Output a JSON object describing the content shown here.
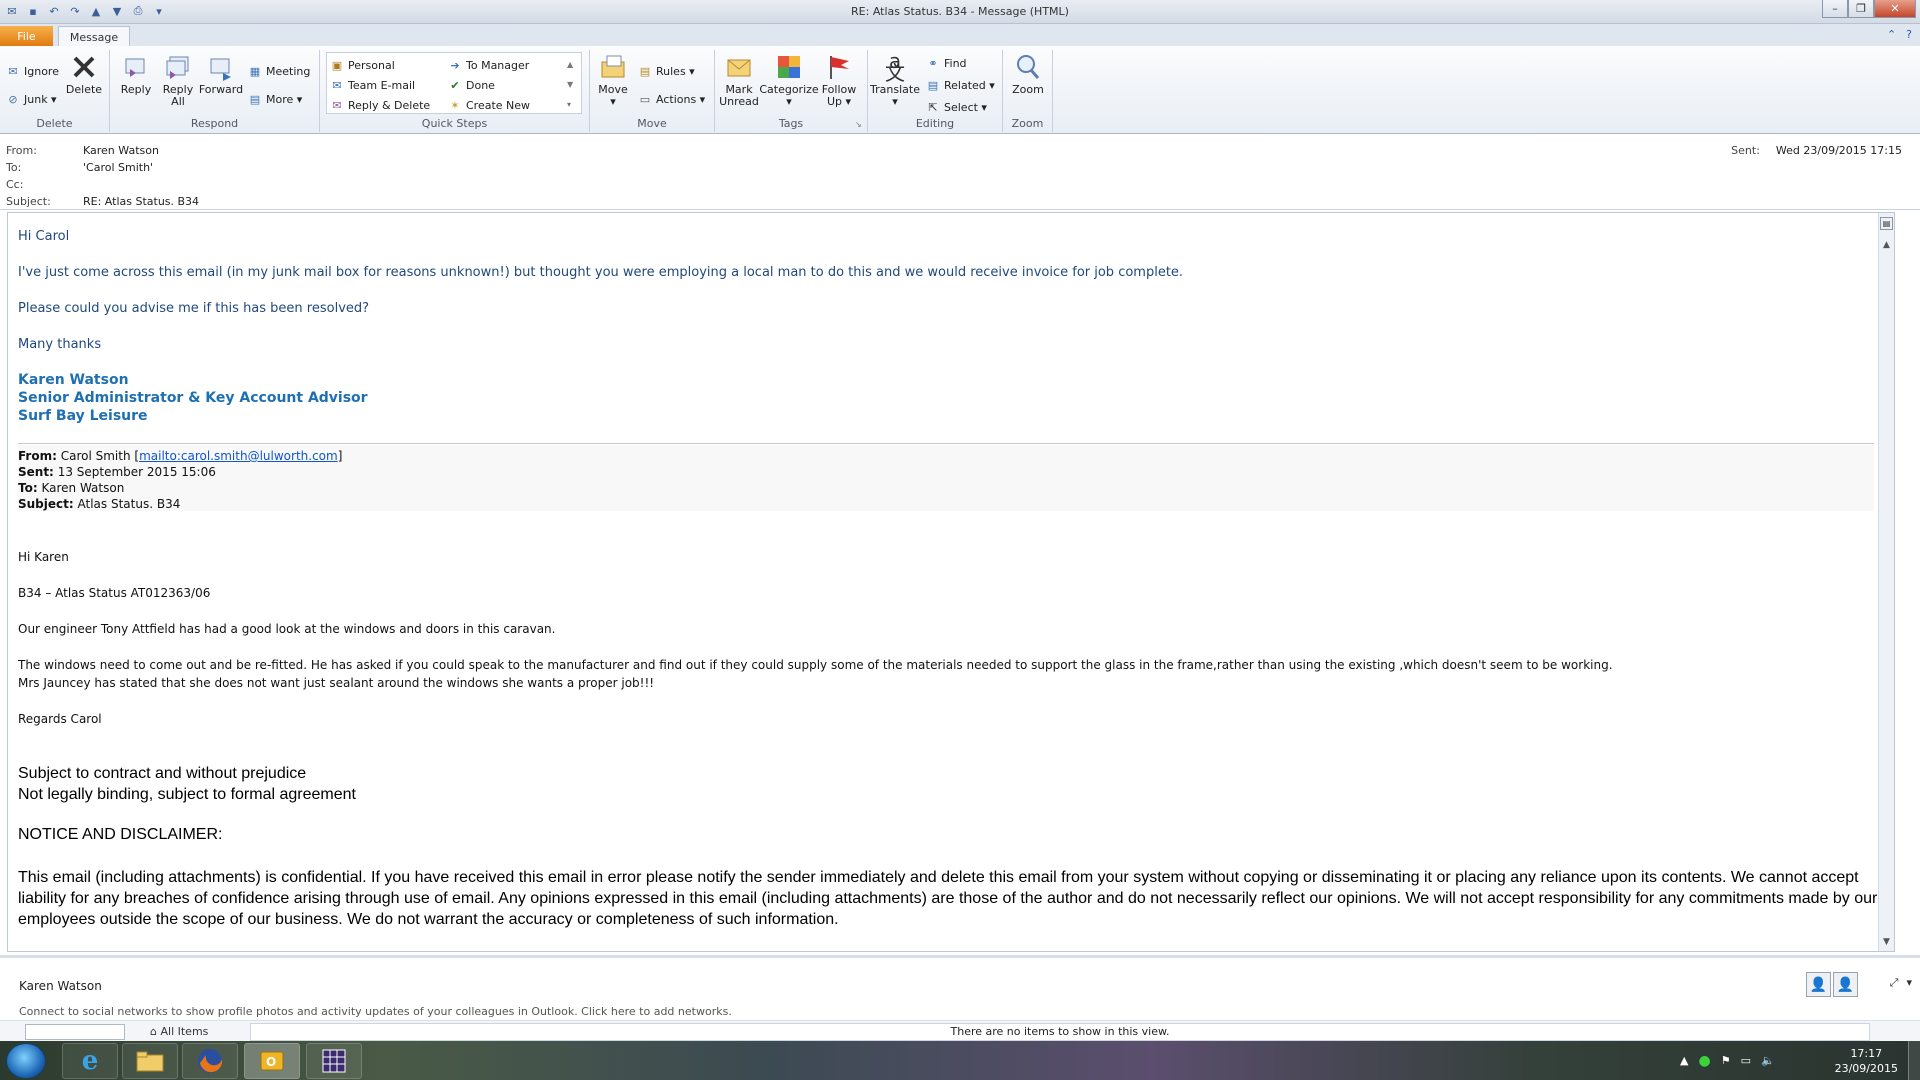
{
  "window": {
    "title": "RE: Atlas Status.  B34  -  Message (HTML)"
  },
  "tabs": {
    "file": "File",
    "message": "Message"
  },
  "ribbon": {
    "delete": {
      "ignore": "Ignore",
      "junk": "Junk ▾",
      "delete": "Delete",
      "label": "Delete"
    },
    "respond": {
      "reply": "Reply",
      "reply_all_1": "Reply",
      "reply_all_2": "All",
      "forward": "Forward",
      "meeting": "Meeting",
      "more": "More ▾",
      "label": "Respond"
    },
    "quick_steps": {
      "personal": "Personal",
      "team_email": "Team E-mail",
      "reply_delete": "Reply & Delete",
      "to_manager": "To Manager",
      "done": "Done",
      "create_new": "Create New",
      "label": "Quick Steps"
    },
    "move": {
      "move_1": "Move",
      "move_2": "▾",
      "rules": "Rules ▾",
      "actions": "Actions ▾",
      "label": "Move"
    },
    "tags": {
      "mark_unread_1": "Mark",
      "mark_unread_2": "Unread",
      "categorize_1": "Categorize",
      "categorize_2": "▾",
      "follow_up_1": "Follow",
      "follow_up_2": "Up ▾",
      "label": "Tags"
    },
    "editing": {
      "translate_1": "Translate",
      "translate_2": "▾",
      "find": "Find",
      "related": "Related ▾",
      "select": "Select ▾",
      "label": "Editing"
    },
    "zoom": {
      "zoom": "Zoom",
      "label": "Zoom"
    }
  },
  "headers": {
    "from_label": "From:",
    "from": "Karen Watson",
    "to_label": "To:",
    "to": "'Carol Smith'",
    "cc_label": "Cc:",
    "cc": "",
    "subject_label": "Subject:",
    "subject": "RE: Atlas Status.  B34",
    "sent_label": "Sent:",
    "sent": "Wed 23/09/2015 17:15"
  },
  "body": {
    "greeting": "Hi Carol",
    "para1": "I've just come across this email (in my junk mail box for reasons unknown!) but thought you were employing a local man to do this and we would receive invoice for job complete.",
    "para2": "Please could you advise me if this has been resolved?",
    "thanks": "Many thanks",
    "sig_name": "Karen Watson",
    "sig_title": "Senior Administrator & Key Account Advisor",
    "sig_company": "Surf Bay Leisure",
    "q_from_label": "From:",
    "q_from": "Carol Smith [",
    "q_mailto": "mailto:carol.smith@lulworth.com",
    "q_from_end": "]",
    "q_sent_label": "Sent:",
    "q_sent": "13 September 2015 15:06",
    "q_to_label": "To:",
    "q_to": "Karen Watson",
    "q_subject_label": "Subject:",
    "q_subject": "Atlas Status. B34",
    "q_greeting": "Hi Karen",
    "q_ref": "B34 – Atlas Status  AT012363/06",
    "q_para1": "Our engineer Tony Attfield has had a good look at the windows and doors in this caravan.",
    "q_para2a": "The windows need to come out and be re-fitted. He has asked if you could speak to the manufacturer and find out if they could supply some of the materials needed to support the glass in the frame,rather than using the existing ,which doesn't seem to be working.",
    "q_para2b": "Mrs Jauncey has stated that she does not want just sealant around the windows she wants a proper job!!!",
    "q_regards": "Regards Carol",
    "legal1": "Subject to contract and without prejudice",
    "legal2": "Not legally binding, subject to formal agreement",
    "notice": "NOTICE AND DISCLAIMER:",
    "disclaimer": "This email (including attachments) is confidential. If you have received this email in error please notify the sender immediately and delete this email from your system without copying or disseminating it or placing any reliance upon its contents. We cannot accept liability for any breaches of confidence arising through use of email. Any opinions expressed in this email (including attachments) are those of the author and do not necessarily reflect our opinions. We will not accept responsibility for any commitments made by our employees outside the scope of our business. We do not warrant the accuracy or completeness of such information."
  },
  "people_pane": {
    "name": "Karen Watson",
    "message": "Connect to social networks to show profile photos and activity updates of your colleagues in Outlook. Click here to add networks.",
    "all_items": "All Items",
    "no_items": "There are no items to show in this view."
  },
  "taskbar": {
    "time": "17:17",
    "date": "23/09/2015"
  },
  "colors": {
    "signature": "#1f6fb3",
    "body_blue": "#1f497d",
    "file_tab": "#e07c12"
  }
}
